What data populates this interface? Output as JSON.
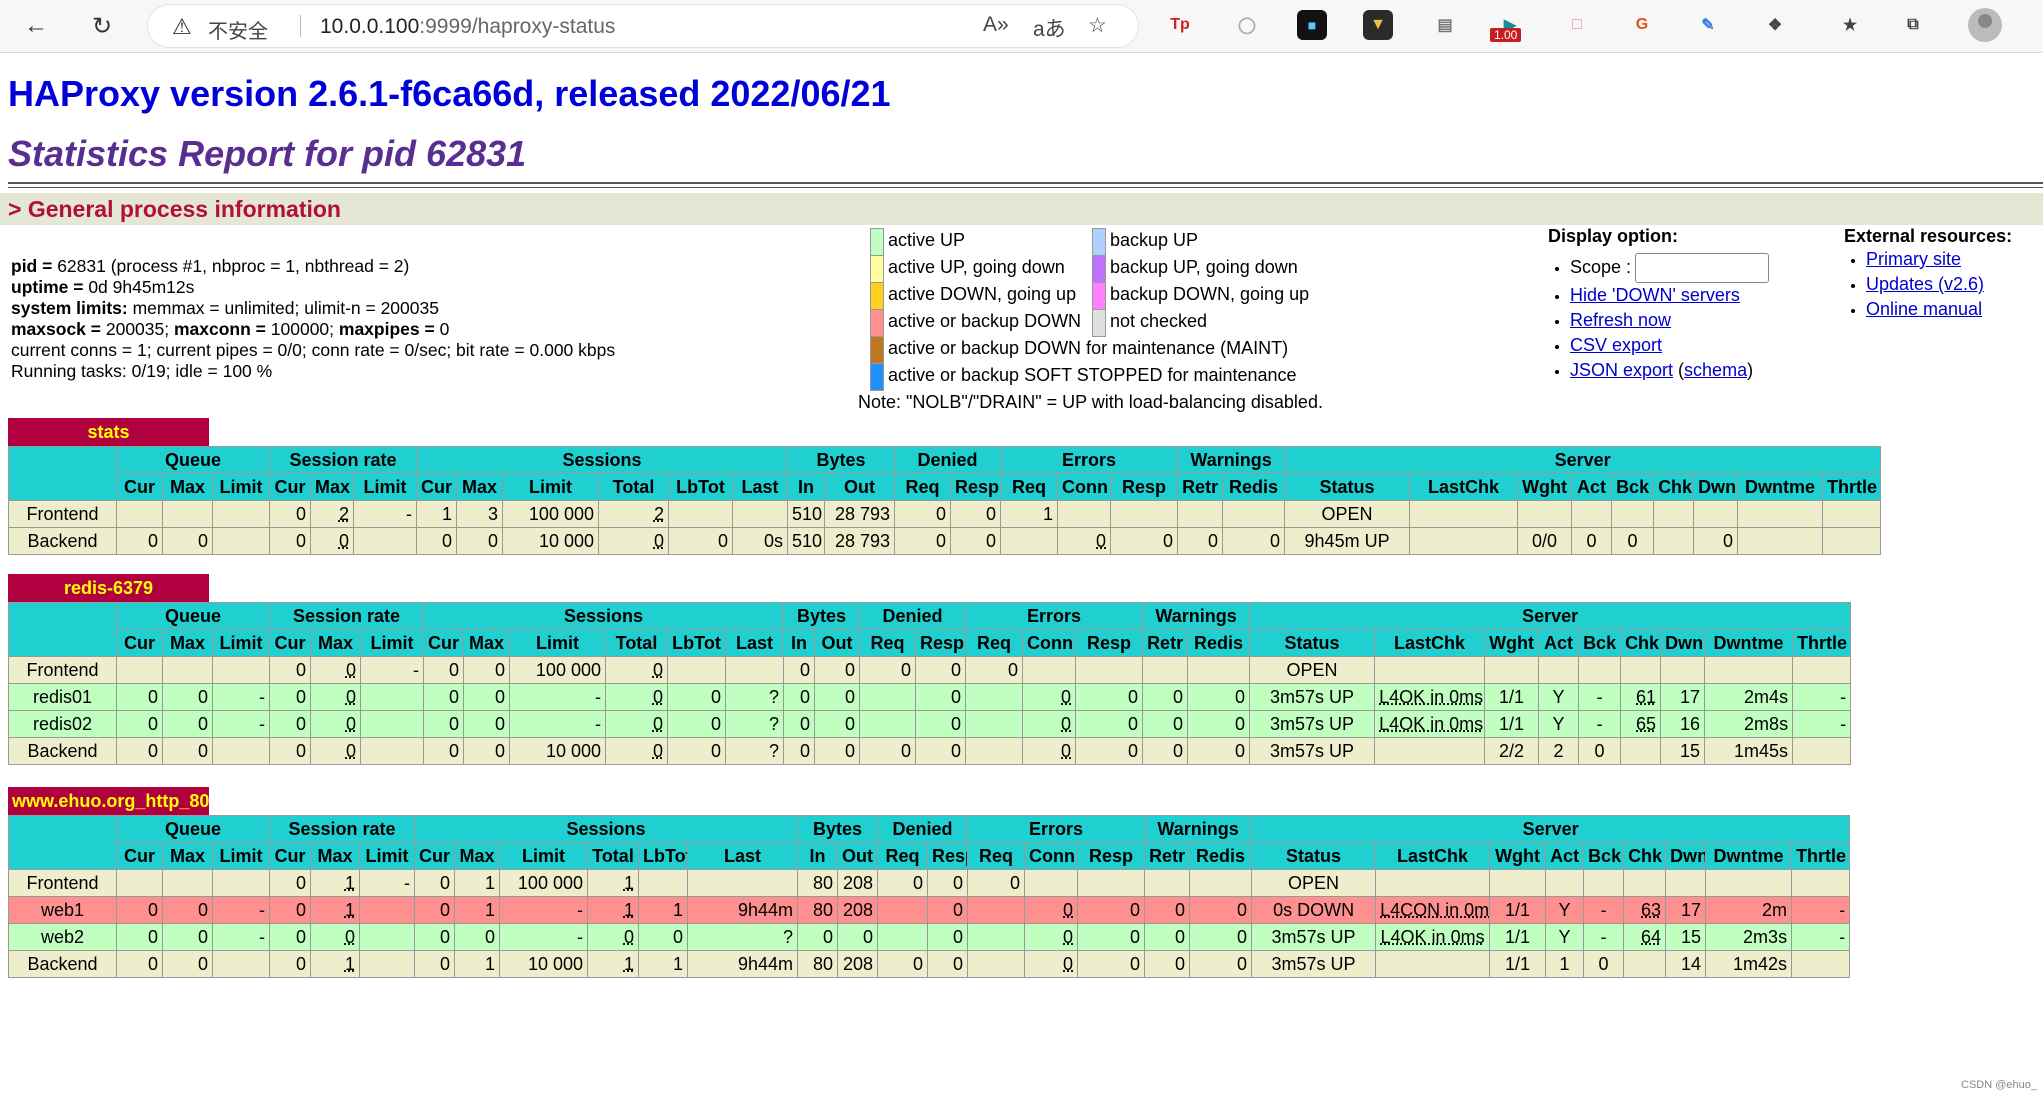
{
  "browser": {
    "security_label": "不安全",
    "url_host": "10.0.0.100",
    "url_rest": ":9999/haproxy-status",
    "read_aloud": "A»",
    "translate": "aあ",
    "ext_tp": "Tp",
    "badge": "1.00",
    "ext_g": "G"
  },
  "page": {
    "title": "HAProxy version 2.6.1-f6ca66d, released 2022/06/21",
    "subtitle": "Statistics Report for pid 62831",
    "section": "> General process information"
  },
  "info": {
    "pid_k": "pid = ",
    "pid_v": "62831 (process #1, nbproc = 1, nbthread = 2)",
    "uptime_k": "uptime = ",
    "uptime_v": "0d 9h45m12s",
    "limits_k": "system limits:",
    "limits_v": " memmax = unlimited; ulimit-n = 200035",
    "maxsock_k": "maxsock = ",
    "maxsock_v": "200035; ",
    "maxconn_k": "maxconn = ",
    "maxconn_v": "100000; ",
    "maxpipes_k": "maxpipes = ",
    "maxpipes_v": "0",
    "conns": "current conns = 1; current pipes = 0/0; conn rate = 0/sec; bit rate = 0.000 kbps",
    "tasks": "Running tasks: 0/19; idle = 100 %"
  },
  "legend": {
    "left": [
      {
        "label": "active UP",
        "color": "#c0ffc0"
      },
      {
        "label": "active UP, going down",
        "color": "#ffffa0"
      },
      {
        "label": "active DOWN, going up",
        "color": "#ffd020"
      },
      {
        "label": "active or backup DOWN",
        "color": "#ff9090"
      },
      {
        "label": "active or backup DOWN for maintenance (MAINT)",
        "color": "#c07820"
      },
      {
        "label": "active or backup SOFT STOPPED for maintenance",
        "color": "#1e90ff"
      }
    ],
    "right": [
      {
        "label": "backup UP",
        "color": "#b0d0ff"
      },
      {
        "label": "backup UP, going down",
        "color": "#c070ff"
      },
      {
        "label": "backup DOWN, going up",
        "color": "#ff80ff"
      },
      {
        "label": "not checked",
        "color": "#e0e0e0"
      }
    ],
    "note": "Note: \"NOLB\"/\"DRAIN\" = UP with load-balancing disabled."
  },
  "display": {
    "title": "Display option:",
    "scope": "Scope :",
    "hide": "Hide 'DOWN' servers",
    "refresh": "Refresh now",
    "csv": "CSV export",
    "json": "JSON export",
    "schema": "schema"
  },
  "external": {
    "title": "External resources:",
    "primary": "Primary site",
    "updates": "Updates (v2.6)",
    "manual": "Online manual"
  },
  "proxies": [
    {
      "name": "stats",
      "rows": [
        {
          "type": "fe",
          "cells": [
            "Frontend",
            "",
            "",
            "",
            "0",
            "2",
            "-",
            "1",
            "3",
            "100 000",
            "2",
            "",
            "",
            "510",
            "28 793",
            "0",
            "0",
            "1",
            "",
            "",
            "",
            "",
            "OPEN",
            "",
            "",
            "",
            "",
            "",
            "",
            "",
            ""
          ]
        },
        {
          "type": "be",
          "cells": [
            "Backend",
            "0",
            "0",
            "",
            "0",
            "0",
            "",
            "0",
            "0",
            "10 000",
            "0",
            "0",
            "0s",
            "510",
            "28 793",
            "0",
            "0",
            "",
            "0",
            "0",
            "0",
            "0",
            "9h45m UP",
            "",
            "0/0",
            "0",
            "0",
            "",
            "0",
            "",
            ""
          ]
        }
      ]
    },
    {
      "name": "redis-6379",
      "rows": [
        {
          "type": "fe",
          "cells": [
            "Frontend",
            "",
            "",
            "",
            "0",
            "0",
            "-",
            "0",
            "0",
            "100 000",
            "0",
            "",
            "",
            "0",
            "0",
            "0",
            "0",
            "0",
            "",
            "",
            "",
            "",
            "OPEN",
            "",
            "",
            "",
            "",
            "",
            "",
            "",
            ""
          ]
        },
        {
          "type": "up",
          "cells": [
            "redis01",
            "0",
            "0",
            "-",
            "0",
            "0",
            "",
            "0",
            "0",
            "-",
            "0",
            "0",
            "?",
            "0",
            "0",
            "",
            "0",
            "",
            "0",
            "0",
            "0",
            "0",
            "3m57s UP",
            "L4OK in 0ms",
            "1/1",
            "Y",
            "-",
            "61",
            "17",
            "2m4s",
            "-"
          ]
        },
        {
          "type": "up",
          "cells": [
            "redis02",
            "0",
            "0",
            "-",
            "0",
            "0",
            "",
            "0",
            "0",
            "-",
            "0",
            "0",
            "?",
            "0",
            "0",
            "",
            "0",
            "",
            "0",
            "0",
            "0",
            "0",
            "3m57s UP",
            "L4OK in 0ms",
            "1/1",
            "Y",
            "-",
            "65",
            "16",
            "2m8s",
            "-"
          ]
        },
        {
          "type": "be",
          "cells": [
            "Backend",
            "0",
            "0",
            "",
            "0",
            "0",
            "",
            "0",
            "0",
            "10 000",
            "0",
            "0",
            "?",
            "0",
            "0",
            "0",
            "0",
            "",
            "0",
            "0",
            "0",
            "0",
            "3m57s UP",
            "",
            "2/2",
            "2",
            "0",
            "",
            "15",
            "1m45s",
            ""
          ]
        }
      ]
    },
    {
      "name": "www.ehuo.org_http_80",
      "rows": [
        {
          "type": "fe",
          "cells": [
            "Frontend",
            "",
            "",
            "",
            "0",
            "1",
            "-",
            "0",
            "1",
            "100 000",
            "1",
            "",
            "",
            "80",
            "208",
            "0",
            "0",
            "0",
            "",
            "",
            "",
            "",
            "OPEN",
            "",
            "",
            "",
            "",
            "",
            "",
            "",
            ""
          ]
        },
        {
          "type": "dn",
          "cells": [
            "web1",
            "0",
            "0",
            "-",
            "0",
            "1",
            "",
            "0",
            "1",
            "-",
            "1",
            "1",
            "9h44m",
            "80",
            "208",
            "",
            "0",
            "",
            "0",
            "0",
            "0",
            "0",
            "0s DOWN",
            "L4CON in 0ms",
            "1/1",
            "Y",
            "-",
            "63",
            "17",
            "2m",
            "-"
          ]
        },
        {
          "type": "up",
          "cells": [
            "web2",
            "0",
            "0",
            "-",
            "0",
            "0",
            "",
            "0",
            "0",
            "-",
            "0",
            "0",
            "?",
            "0",
            "0",
            "",
            "0",
            "",
            "0",
            "0",
            "0",
            "0",
            "3m57s UP",
            "L4OK in 0ms",
            "1/1",
            "Y",
            "-",
            "64",
            "15",
            "2m3s",
            "-"
          ]
        },
        {
          "type": "be",
          "cells": [
            "Backend",
            "0",
            "0",
            "",
            "0",
            "1",
            "",
            "0",
            "1",
            "10 000",
            "1",
            "1",
            "9h44m",
            "80",
            "208",
            "0",
            "0",
            "",
            "0",
            "0",
            "0",
            "0",
            "3m57s UP",
            "",
            "1/1",
            "1",
            "0",
            "",
            "14",
            "1m42s",
            ""
          ]
        }
      ]
    }
  ],
  "groups": [
    "Queue",
    "Session rate",
    "Sessions",
    "Bytes",
    "Denied",
    "Errors",
    "Warnings",
    "Server"
  ],
  "columns": [
    "Cur",
    "Max",
    "Limit",
    "Cur",
    "Max",
    "Limit",
    "Cur",
    "Max",
    "Limit",
    "Total",
    "LbTot",
    "Last",
    "In",
    "Out",
    "Req",
    "Resp",
    "Req",
    "Conn",
    "Resp",
    "Retr",
    "Redis",
    "Status",
    "LastChk",
    "Wght",
    "Act",
    "Bck",
    "Chk",
    "Dwn",
    "Dwntme",
    "Thrtle"
  ],
  "watermark": "CSDN @ehuo_"
}
